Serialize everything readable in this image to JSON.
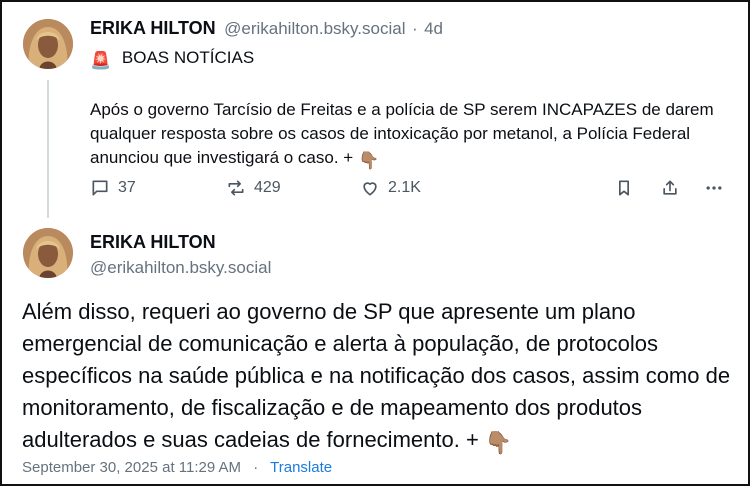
{
  "first_post": {
    "name": "ERIKA HILTON",
    "handle": "@erikahilton.bsky.social",
    "separator": "·",
    "age": "4d",
    "headline_emoji": "🚨",
    "headline": "BOAS NOTÍCIAS",
    "body": "Após o governo Tarcísio de Freitas e a polícia de SP serem INCAPAZES de darem qualquer resposta sobre os casos de intoxicação por metanol, a Polícia Federal anunciou que investigará o caso. +",
    "trailing_emoji": "👇🏽",
    "actions": {
      "replies": "37",
      "reposts": "429",
      "likes": "2.1K"
    }
  },
  "second_post": {
    "name": "ERIKA HILTON",
    "handle": "@erikahilton.bsky.social",
    "body": "Além disso, requeri ao governo de SP que apresente um plano emergencial de comunicação e alerta à população, de protocolos específicos na saúde pública e na notificação dos casos, assim como de monitoramento, de fiscalização e de mapeamento dos produtos adulterados e suas cadeias de fornecimento. +",
    "trailing_emoji": "👇🏽",
    "timestamp": "September 30, 2025 at 11:29 AM",
    "separator": "·",
    "translate_label": "Translate"
  },
  "icons": {
    "reply": "speech-bubble-icon",
    "repost": "repost-arrows-icon",
    "like": "heart-icon",
    "bookmark": "bookmark-icon",
    "share": "share-icon",
    "more": "ellipsis-icon"
  },
  "colors": {
    "text": "#0b0f14",
    "muted": "#66727e",
    "link": "#1d7bdf",
    "thread_line": "#cfd9de"
  }
}
